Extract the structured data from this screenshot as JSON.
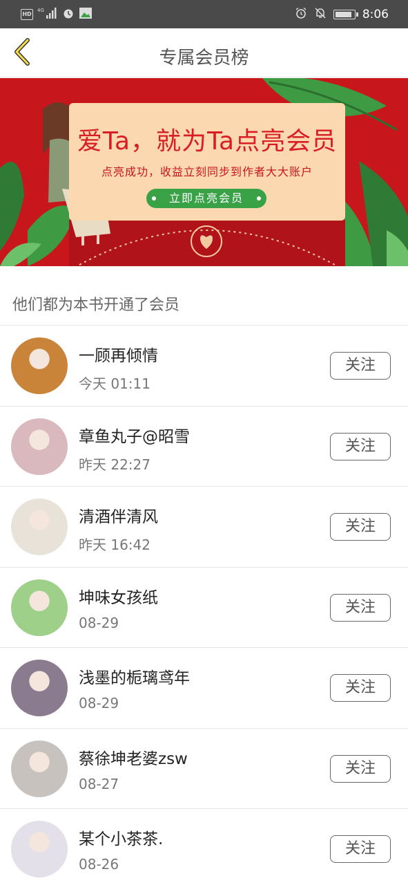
{
  "status_bar": {
    "left_icons": [
      "hd-icon",
      "4g-signal-icon",
      "alarm-icon",
      "image-icon"
    ],
    "hd": "HD",
    "network": "4G",
    "right_icons": [
      "alarm-icon",
      "mute-icon",
      "battery-icon"
    ],
    "battery_level": 0.9,
    "time": "8:06"
  },
  "header": {
    "back_icon": "chevron-left-icon",
    "title": "专属会员榜"
  },
  "banner": {
    "headline": "爱Ta，就为Ta点亮会员",
    "subtitle": "点亮成功，收益立刻同步到作者大大账户",
    "button_label": "立即点亮会员",
    "colors": {
      "background": "#c8161d",
      "card": "#fbd8b0",
      "button": "#39a247",
      "headline": "#d81e24"
    }
  },
  "section": {
    "title": "他们都为本书开通了会员"
  },
  "members": [
    {
      "name": "一顾再倾情",
      "time": "今天 01:11",
      "follow_label": "关注",
      "avatar_color": "#c9843a"
    },
    {
      "name": "章鱼丸子@昭雪",
      "time": "昨天 22:27",
      "follow_label": "关注",
      "avatar_color": "#d9b8be"
    },
    {
      "name": "清酒伴清风",
      "time": "昨天 16:42",
      "follow_label": "关注",
      "avatar_color": "#e8e2d8"
    },
    {
      "name": "坤味女孩纸",
      "time": "08-29",
      "follow_label": "关注",
      "avatar_color": "#9fd08a"
    },
    {
      "name": "浅墨的栀璃鸢年",
      "time": "08-29",
      "follow_label": "关注",
      "avatar_color": "#8a7c8e"
    },
    {
      "name": "蔡徐坤老婆zsw",
      "time": "08-27",
      "follow_label": "关注",
      "avatar_color": "#c7c2bd"
    },
    {
      "name": "某个小茶茶.",
      "time": "08-26",
      "follow_label": "关注",
      "avatar_color": "#e3e0ea"
    }
  ]
}
